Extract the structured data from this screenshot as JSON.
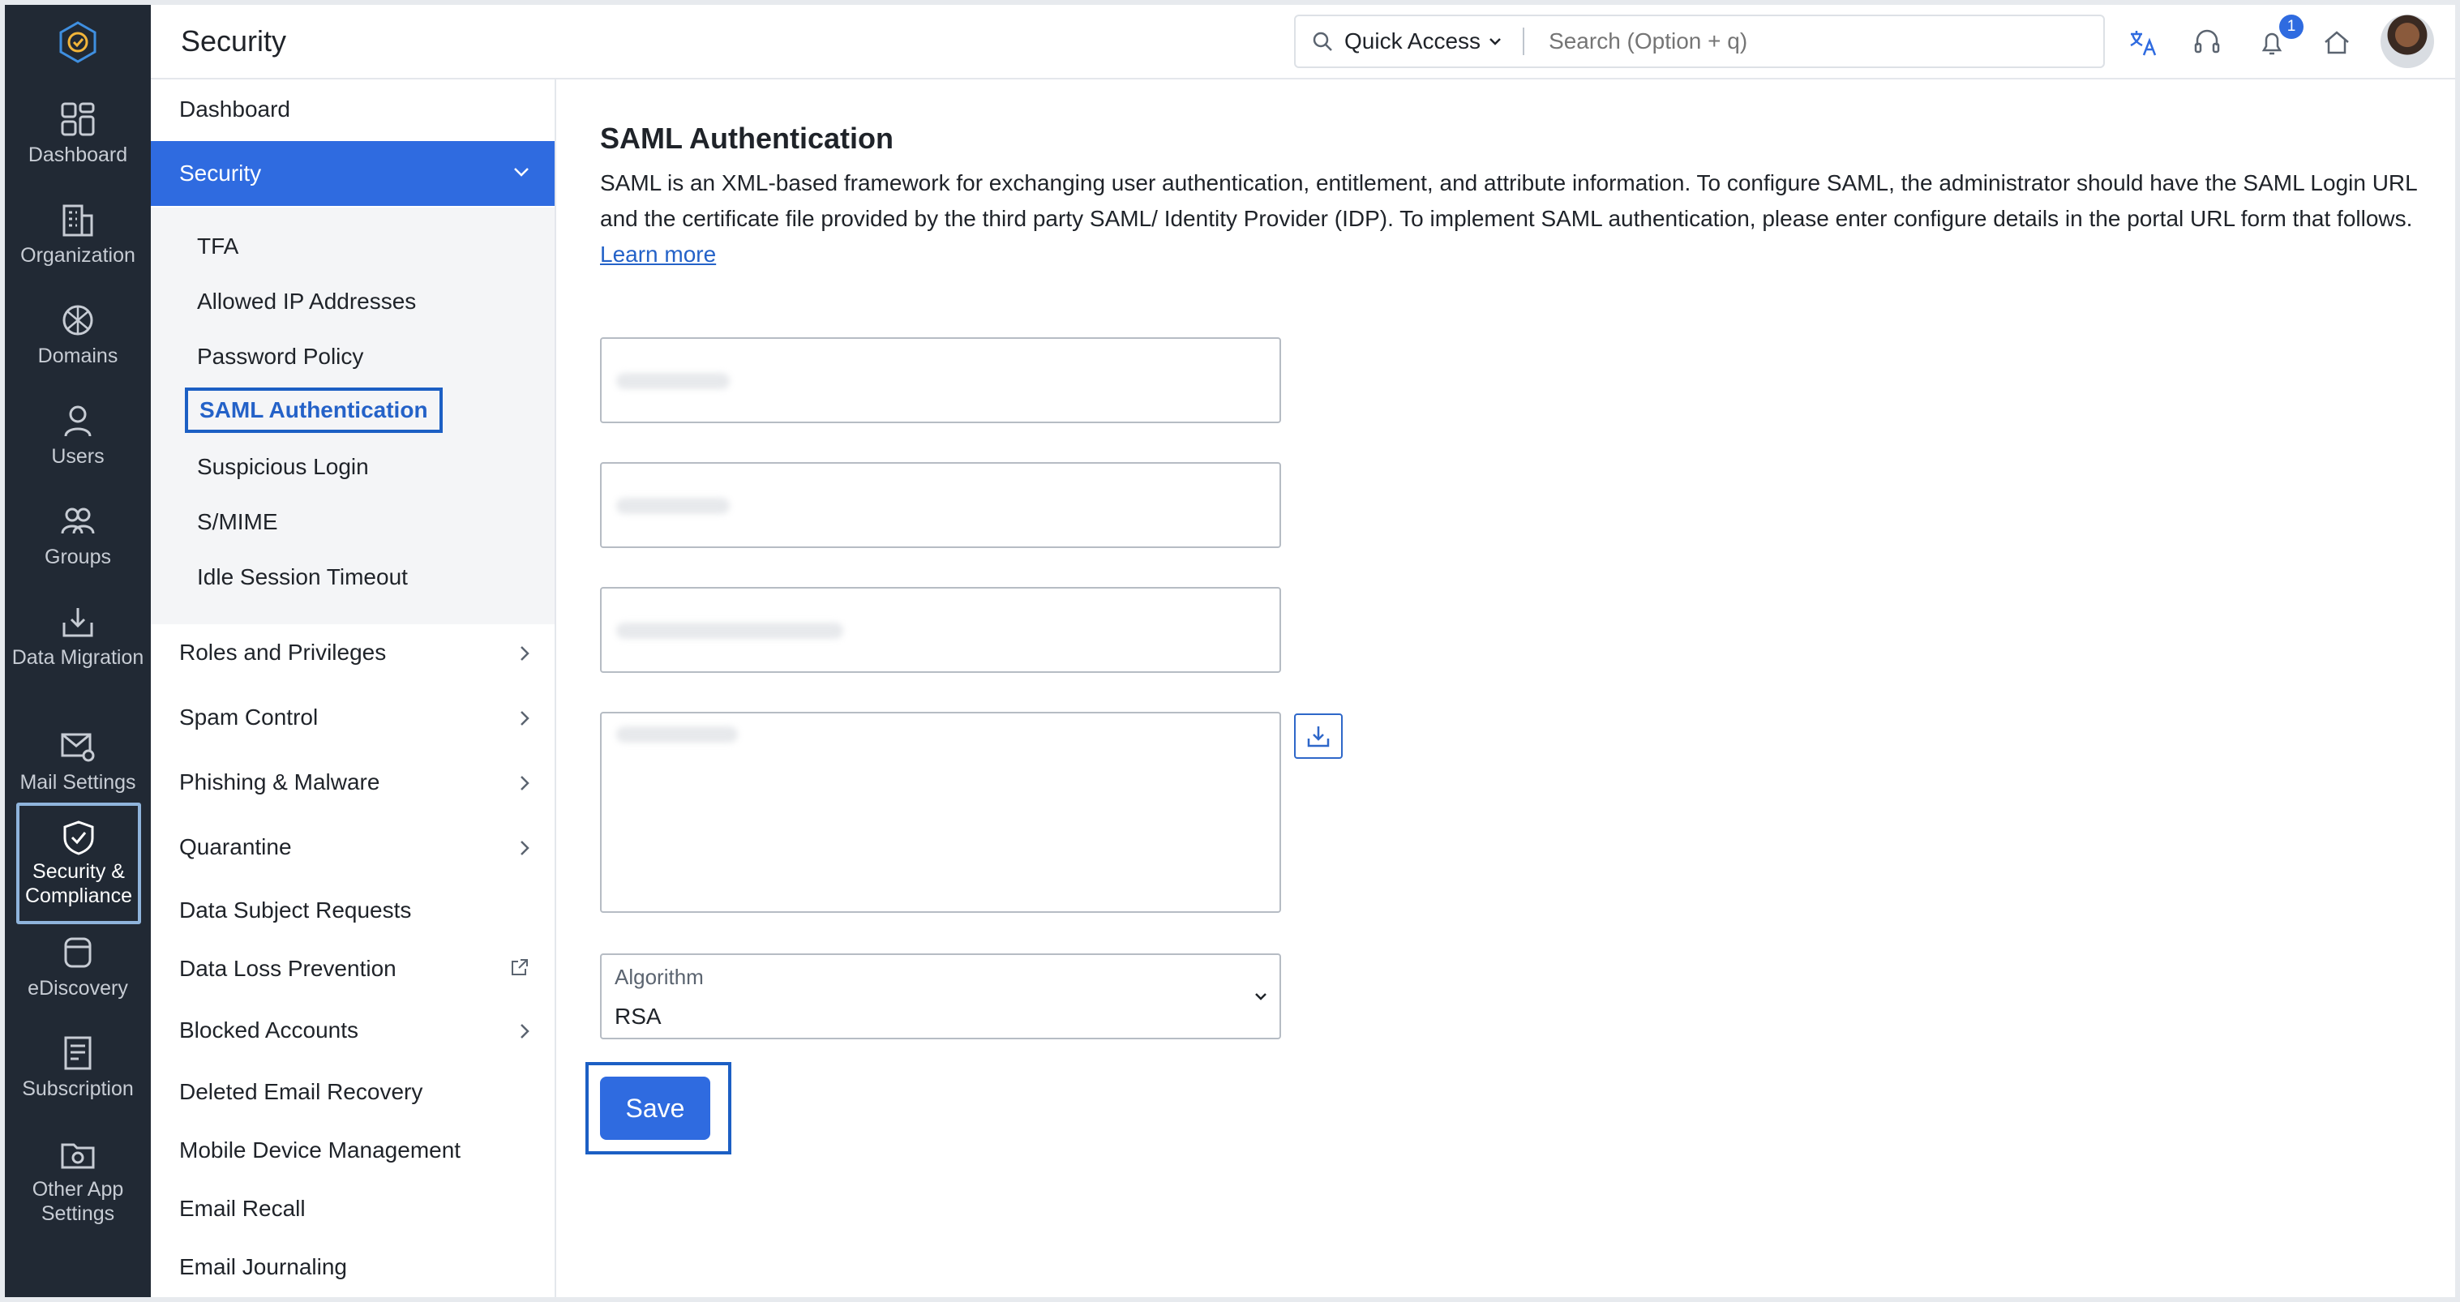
{
  "header": {
    "title": "Security",
    "quick_access": "Quick Access",
    "search_placeholder": "Search (Option + q)",
    "notification_count": "1"
  },
  "rail": {
    "items": [
      {
        "label": "Dashboard",
        "icon": "dashboard-icon"
      },
      {
        "label": "Organization",
        "icon": "organization-icon"
      },
      {
        "label": "Domains",
        "icon": "domains-icon"
      },
      {
        "label": "Users",
        "icon": "user-icon"
      },
      {
        "label": "Groups",
        "icon": "groups-icon"
      },
      {
        "label": "Data Migration",
        "icon": "data-migration-icon"
      },
      {
        "label": "Mail Settings",
        "icon": "mail-settings-icon"
      },
      {
        "label": "Security & Compliance",
        "icon": "shield-check-icon"
      },
      {
        "label": "eDiscovery",
        "icon": "ediscovery-icon"
      },
      {
        "label": "Subscription",
        "icon": "subscription-icon"
      },
      {
        "label": "Other App Settings",
        "icon": "app-settings-icon"
      }
    ]
  },
  "subnav": {
    "dashboard": "Dashboard",
    "security": "Security",
    "security_items": [
      "TFA",
      "Allowed IP Addresses",
      "Password Policy",
      "SAML Authentication",
      "Suspicious Login",
      "S/MIME",
      "Idle Session Timeout"
    ],
    "sections": [
      "Roles and Privileges",
      "Spam Control",
      "Phishing & Malware",
      "Quarantine",
      "Data Subject Requests",
      "Data Loss Prevention",
      "Blocked Accounts",
      "Deleted Email Recovery",
      "Mobile Device Management",
      "Email Recall",
      "Email Journaling"
    ]
  },
  "main": {
    "title": "SAML Authentication",
    "description": "SAML is an XML-based framework for exchanging user authentication, entitlement, and attribute information. To configure SAML, the administrator should have the SAML Login URL and the certificate file provided by the third party SAML/ Identity Provider (IDP). To implement SAML authentication, please enter configure details in the portal URL form that follows.",
    "learn_more": "Learn more",
    "algorithm_label": "Algorithm",
    "algorithm_value": "RSA",
    "save_label": "Save"
  },
  "colors": {
    "rail_bg": "#212934",
    "accent": "#2f6be0",
    "highlight_border": "#1c5fc4"
  }
}
